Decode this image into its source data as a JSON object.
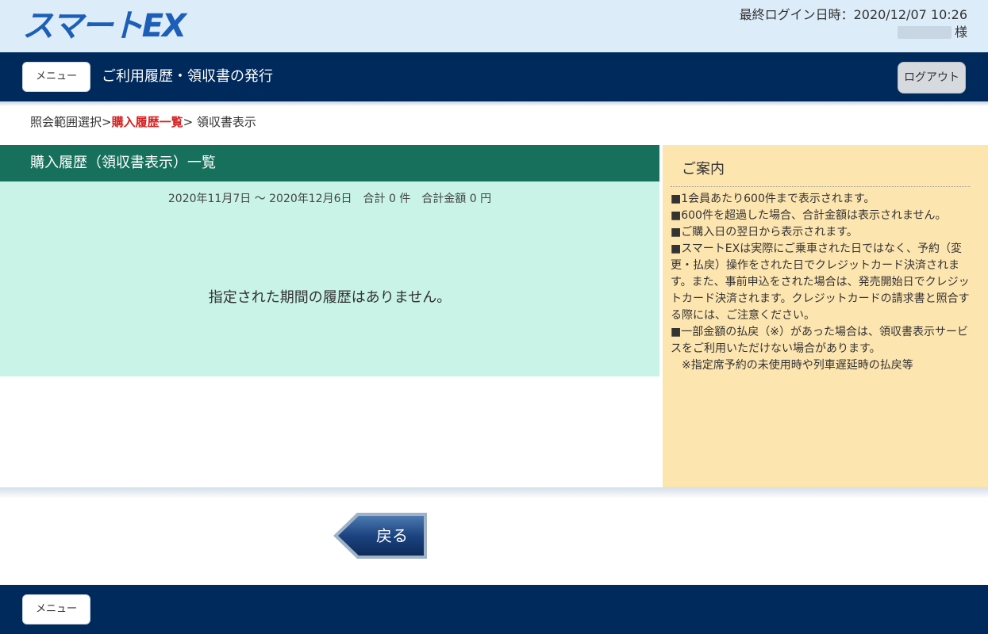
{
  "header": {
    "logo_text": "スマートEX",
    "last_login": "最終ログイン日時：2020/12/07 10:26",
    "user_suffix": "様"
  },
  "nav": {
    "menu_label": "メニュー",
    "title": "ご利用履歴・領収書の発行",
    "logout_label": "ログアウト"
  },
  "breadcrumb": {
    "step1": "照会範囲選択>",
    "step2": "購入履歴一覧",
    "step3": "> 領収書表示"
  },
  "main": {
    "title": "購入履歴（領収書表示）一覧",
    "summary": "2020年11月7日 ～ 2020年12月6日　合計 0 件　合計金額 0 円",
    "empty_message": "指定された期間の履歴はありません。"
  },
  "info": {
    "title": "ご案内",
    "items": [
      "■1会員あたり600件まで表示されます。",
      "■600件を超過した場合、合計金額は表示されません。",
      "■ご購入日の翌日から表示されます。",
      "■スマートEXは実際にご乗車された日ではなく、予約（変更・払戻）操作をされた日でクレジットカード決済されます。また、事前申込をされた場合は、発売開始日でクレジットカード決済されます。クレジットカードの請求書と照合する際には、ご注意ください。",
      "■一部金額の払戻（※）があった場合は、領収書表示サービスをご利用いただけない場合があります。",
      "　※指定席予約の未使用時や列車遅延時の払戻等"
    ]
  },
  "back_button": {
    "label": "戻る"
  },
  "footer": {
    "menu_label": "メニュー"
  },
  "colors": {
    "navy": "#002a5c",
    "header_green": "#16705c",
    "panel_mint": "#c8f3e6",
    "info_yellow": "#fde5b0",
    "breadcrumb_current": "#d42222"
  }
}
